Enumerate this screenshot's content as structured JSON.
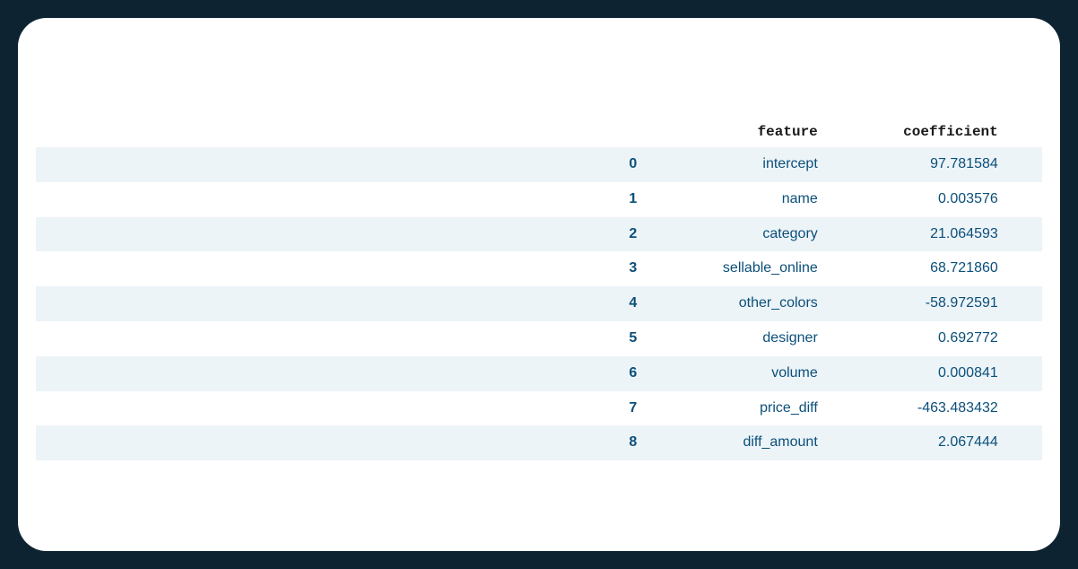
{
  "table": {
    "headers": {
      "feature": "feature",
      "coefficient": "coefficient"
    },
    "rows": [
      {
        "index": "0",
        "feature": "intercept",
        "coefficient": "97.781584"
      },
      {
        "index": "1",
        "feature": "name",
        "coefficient": "0.003576"
      },
      {
        "index": "2",
        "feature": "category",
        "coefficient": "21.064593"
      },
      {
        "index": "3",
        "feature": "sellable_online",
        "coefficient": "68.721860"
      },
      {
        "index": "4",
        "feature": "other_colors",
        "coefficient": "-58.972591"
      },
      {
        "index": "5",
        "feature": "designer",
        "coefficient": "0.692772"
      },
      {
        "index": "6",
        "feature": "volume",
        "coefficient": "0.000841"
      },
      {
        "index": "7",
        "feature": "price_diff",
        "coefficient": "-463.483432"
      },
      {
        "index": "8",
        "feature": "diff_amount",
        "coefficient": "2.067444"
      }
    ]
  }
}
